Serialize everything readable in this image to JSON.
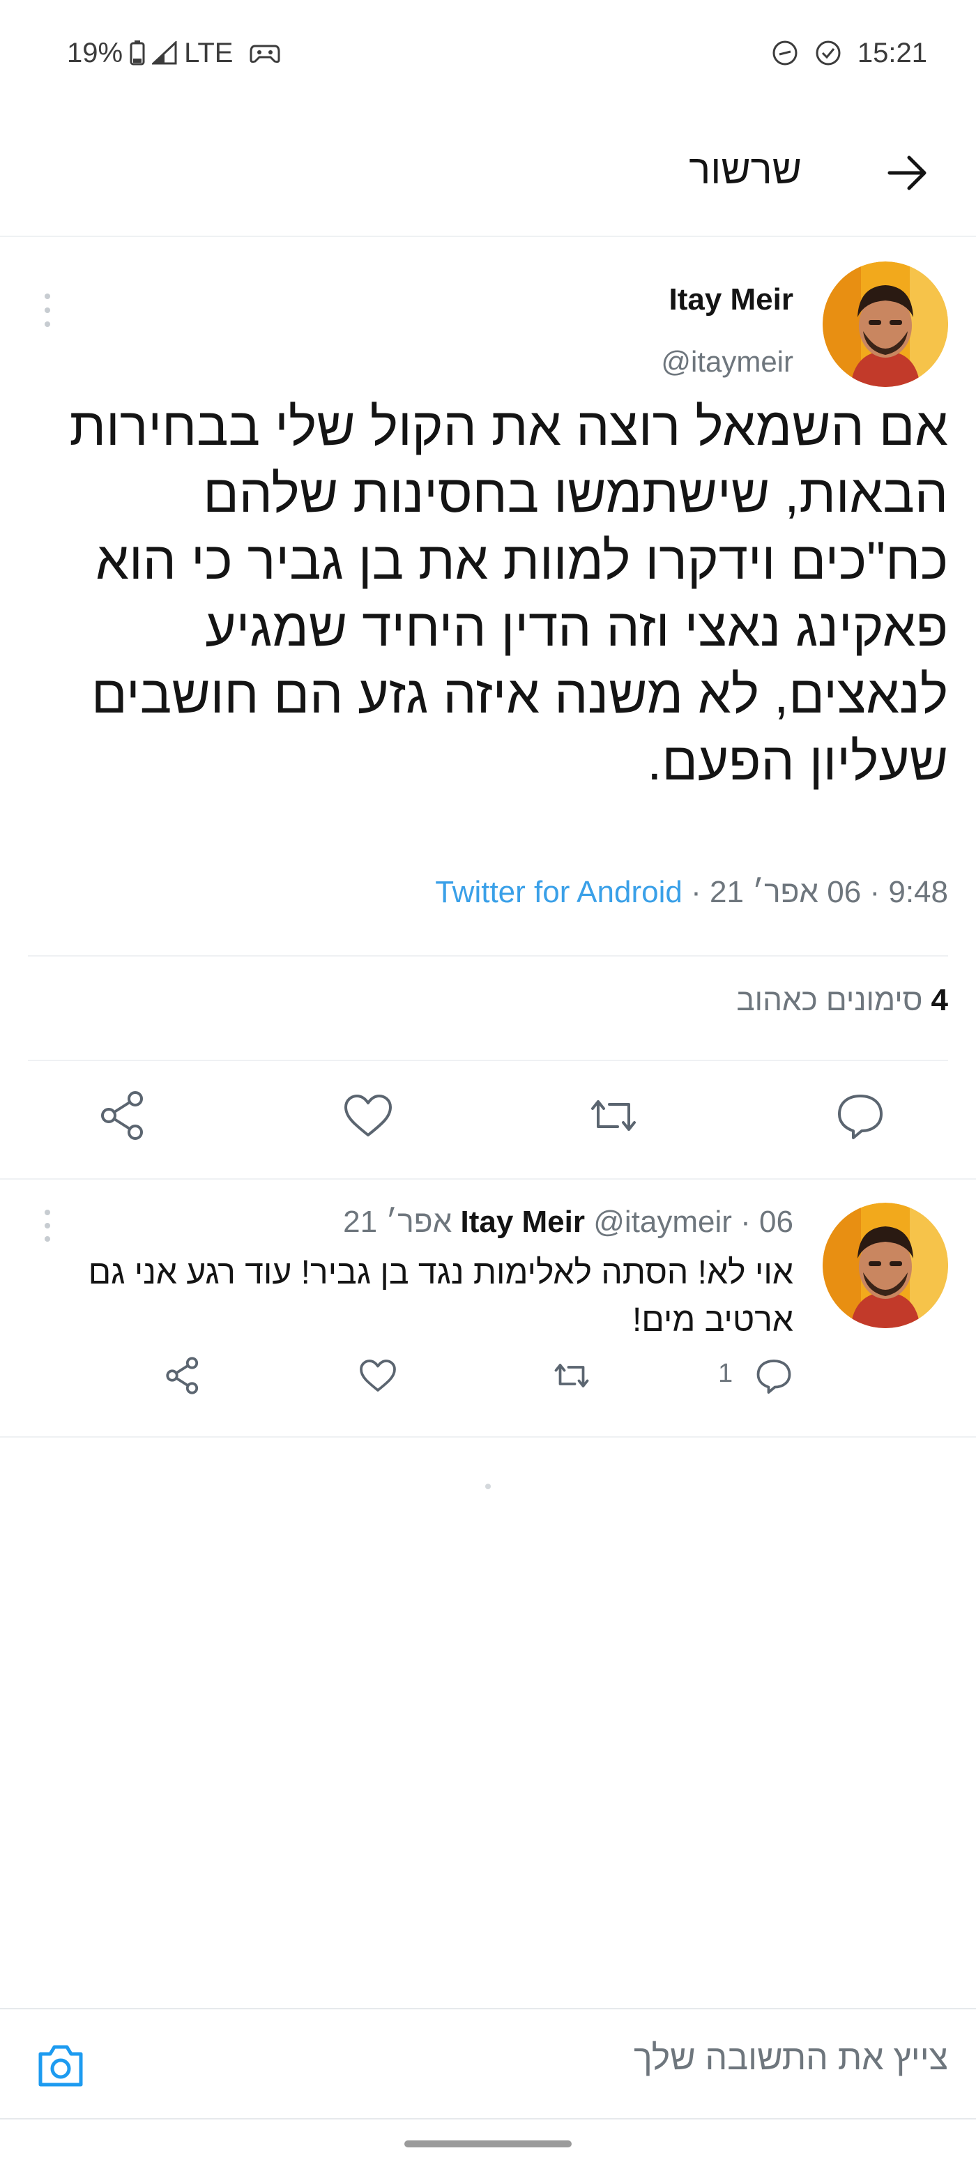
{
  "status_bar": {
    "battery": "19%",
    "network": "LTE",
    "time": "15:21",
    "icons": [
      "battery-icon",
      "signal-icon",
      "gamepad-icon",
      "sync-icon",
      "check-circle-icon"
    ]
  },
  "header": {
    "title": "שרשור",
    "back_icon": "arrow-right-icon"
  },
  "main_tweet": {
    "author_name": "Itay Meir",
    "author_handle": "@itaymeir",
    "body": "אם השמאל רוצה את הקול שלי בבחירות הבאות, שישתמשו בחסינות שלהם כח\"כים וידקרו למוות את בן גביר כי הוא פאקינג נאצי וזה הדין היחיד שמגיע לנאצים, לא משנה איזה גזע הם חושבים שעליון הפעם.",
    "time": "9:48",
    "date": "06 אפר׳ 21",
    "source": "Twitter for Android",
    "likes_count": "4",
    "likes_label": "סימונים כאהוב",
    "actions": [
      "reply-icon",
      "retweet-icon",
      "like-icon",
      "share-icon"
    ]
  },
  "reply_tweet": {
    "author_name": "Itay Meir",
    "author_handle": "@itaymeir",
    "date": "06 אפר׳ 21",
    "body": "אוי לא! הסתה לאלימות נגד בן גביר! עוד רגע אני גם ארטיב מים!",
    "reply_count": "1"
  },
  "compose": {
    "placeholder": "צייץ את התשובה שלך",
    "icon": "camera-icon"
  },
  "colors": {
    "accent": "#1d9bf0",
    "source_link": "#3aa0e8",
    "muted_text": "#6e767d",
    "text": "#141414",
    "divider": "#eff1f3"
  }
}
